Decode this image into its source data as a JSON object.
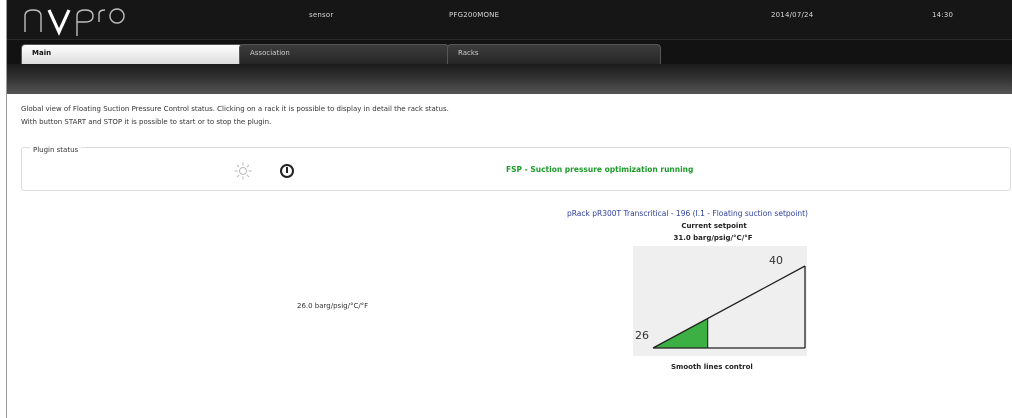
{
  "header": {
    "logo_text": "pvpro",
    "user": "sensor",
    "host": "PFG200MONE",
    "date": "2014/07/24",
    "time": "14:30"
  },
  "tabs": [
    {
      "label": "Main",
      "active": true
    },
    {
      "label": "Association",
      "active": false
    },
    {
      "label": "Racks",
      "active": false
    }
  ],
  "description": {
    "line1": "Global view of Floating Suction Pressure Control status. Clicking on a rack it is possible to display in detail the rack status.",
    "line2": "With button START and STOP it is possible to start or to stop the plugin."
  },
  "plugin_status": {
    "legend": "Plugin status",
    "icons": [
      "sun-icon",
      "power-icon"
    ],
    "status_text": "FSP - Suction pressure optimization running",
    "status_color": "#1c9a2a"
  },
  "rack": {
    "link_text": "pRack pR300T Transcritical - 196 (I.1 - Floating suction setpoint)",
    "current_setpoint_label": "Current setpoint",
    "current_setpoint_value": "31.0 barg/psig/°C/°F",
    "min_value_text": "26.0 barg/psig/°C/°F",
    "graph_max": "40",
    "graph_min": "26",
    "graph_fill_fraction": 0.36,
    "graph_fill_color": "#3cb043",
    "control_mode": "Smooth lines control"
  }
}
